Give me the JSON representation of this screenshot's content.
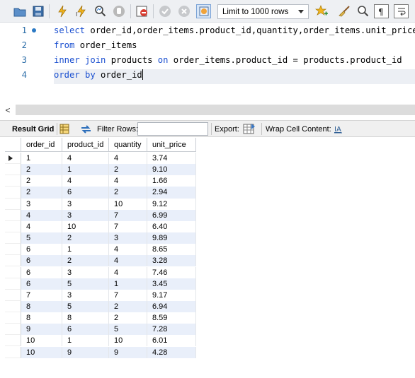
{
  "toolbar": {
    "icons": [
      "folder-icon",
      "save-icon",
      "execute-icon",
      "execute-statement-icon",
      "explain-icon",
      "stop-icon",
      "toggle-continue-icon",
      "commit-icon",
      "rollback-icon",
      "autocommit-icon",
      "beautify-icon",
      "find-icon",
      "invisible-chars-icon",
      "wrap-icon"
    ],
    "limit_label": "Limit to 1000 rows"
  },
  "editor": {
    "lines": [
      {
        "number": "1",
        "tokens": [
          {
            "t": "select",
            "kw": true
          },
          {
            "t": " order_id,order_items.product_id,quantity,order_items.unit_price",
            "kw": false
          }
        ]
      },
      {
        "number": "2",
        "tokens": [
          {
            "t": "from",
            "kw": true
          },
          {
            "t": " order_items",
            "kw": false
          }
        ]
      },
      {
        "number": "3",
        "tokens": [
          {
            "t": "inner join",
            "kw": true
          },
          {
            "t": " products ",
            "kw": false
          },
          {
            "t": "on",
            "kw": true
          },
          {
            "t": " order_items.product_id = products.product_id",
            "kw": false
          }
        ]
      },
      {
        "number": "4",
        "tokens": [
          {
            "t": "order by",
            "kw": true
          },
          {
            "t": " order_id",
            "kw": false
          }
        ]
      }
    ]
  },
  "scrollbar": {
    "left_arrow": "<"
  },
  "result_toolbar": {
    "result_grid": "Result Grid",
    "filter_rows": "Filter Rows:",
    "filter_value": "",
    "export": "Export:",
    "wrap_cell_content": "Wrap Cell Content:"
  },
  "grid": {
    "columns": [
      "order_id",
      "product_id",
      "quantity",
      "unit_price"
    ],
    "rows": [
      [
        "1",
        "4",
        "4",
        "3.74"
      ],
      [
        "2",
        "1",
        "2",
        "9.10"
      ],
      [
        "2",
        "4",
        "4",
        "1.66"
      ],
      [
        "2",
        "6",
        "2",
        "2.94"
      ],
      [
        "3",
        "3",
        "10",
        "9.12"
      ],
      [
        "4",
        "3",
        "7",
        "6.99"
      ],
      [
        "4",
        "10",
        "7",
        "6.40"
      ],
      [
        "5",
        "2",
        "3",
        "9.89"
      ],
      [
        "6",
        "1",
        "4",
        "8.65"
      ],
      [
        "6",
        "2",
        "4",
        "3.28"
      ],
      [
        "6",
        "3",
        "4",
        "7.46"
      ],
      [
        "6",
        "5",
        "1",
        "3.45"
      ],
      [
        "7",
        "3",
        "7",
        "9.17"
      ],
      [
        "8",
        "5",
        "2",
        "6.94"
      ],
      [
        "8",
        "8",
        "2",
        "8.59"
      ],
      [
        "9",
        "6",
        "5",
        "7.28"
      ],
      [
        "10",
        "1",
        "10",
        "6.01"
      ],
      [
        "10",
        "9",
        "9",
        "4.28"
      ]
    ]
  },
  "colors": {
    "keyword": "#1a4fd0",
    "line_number": "#2d6ea8",
    "alt_row": "#e9effa",
    "toolbar_bg": "#eef0f3"
  }
}
